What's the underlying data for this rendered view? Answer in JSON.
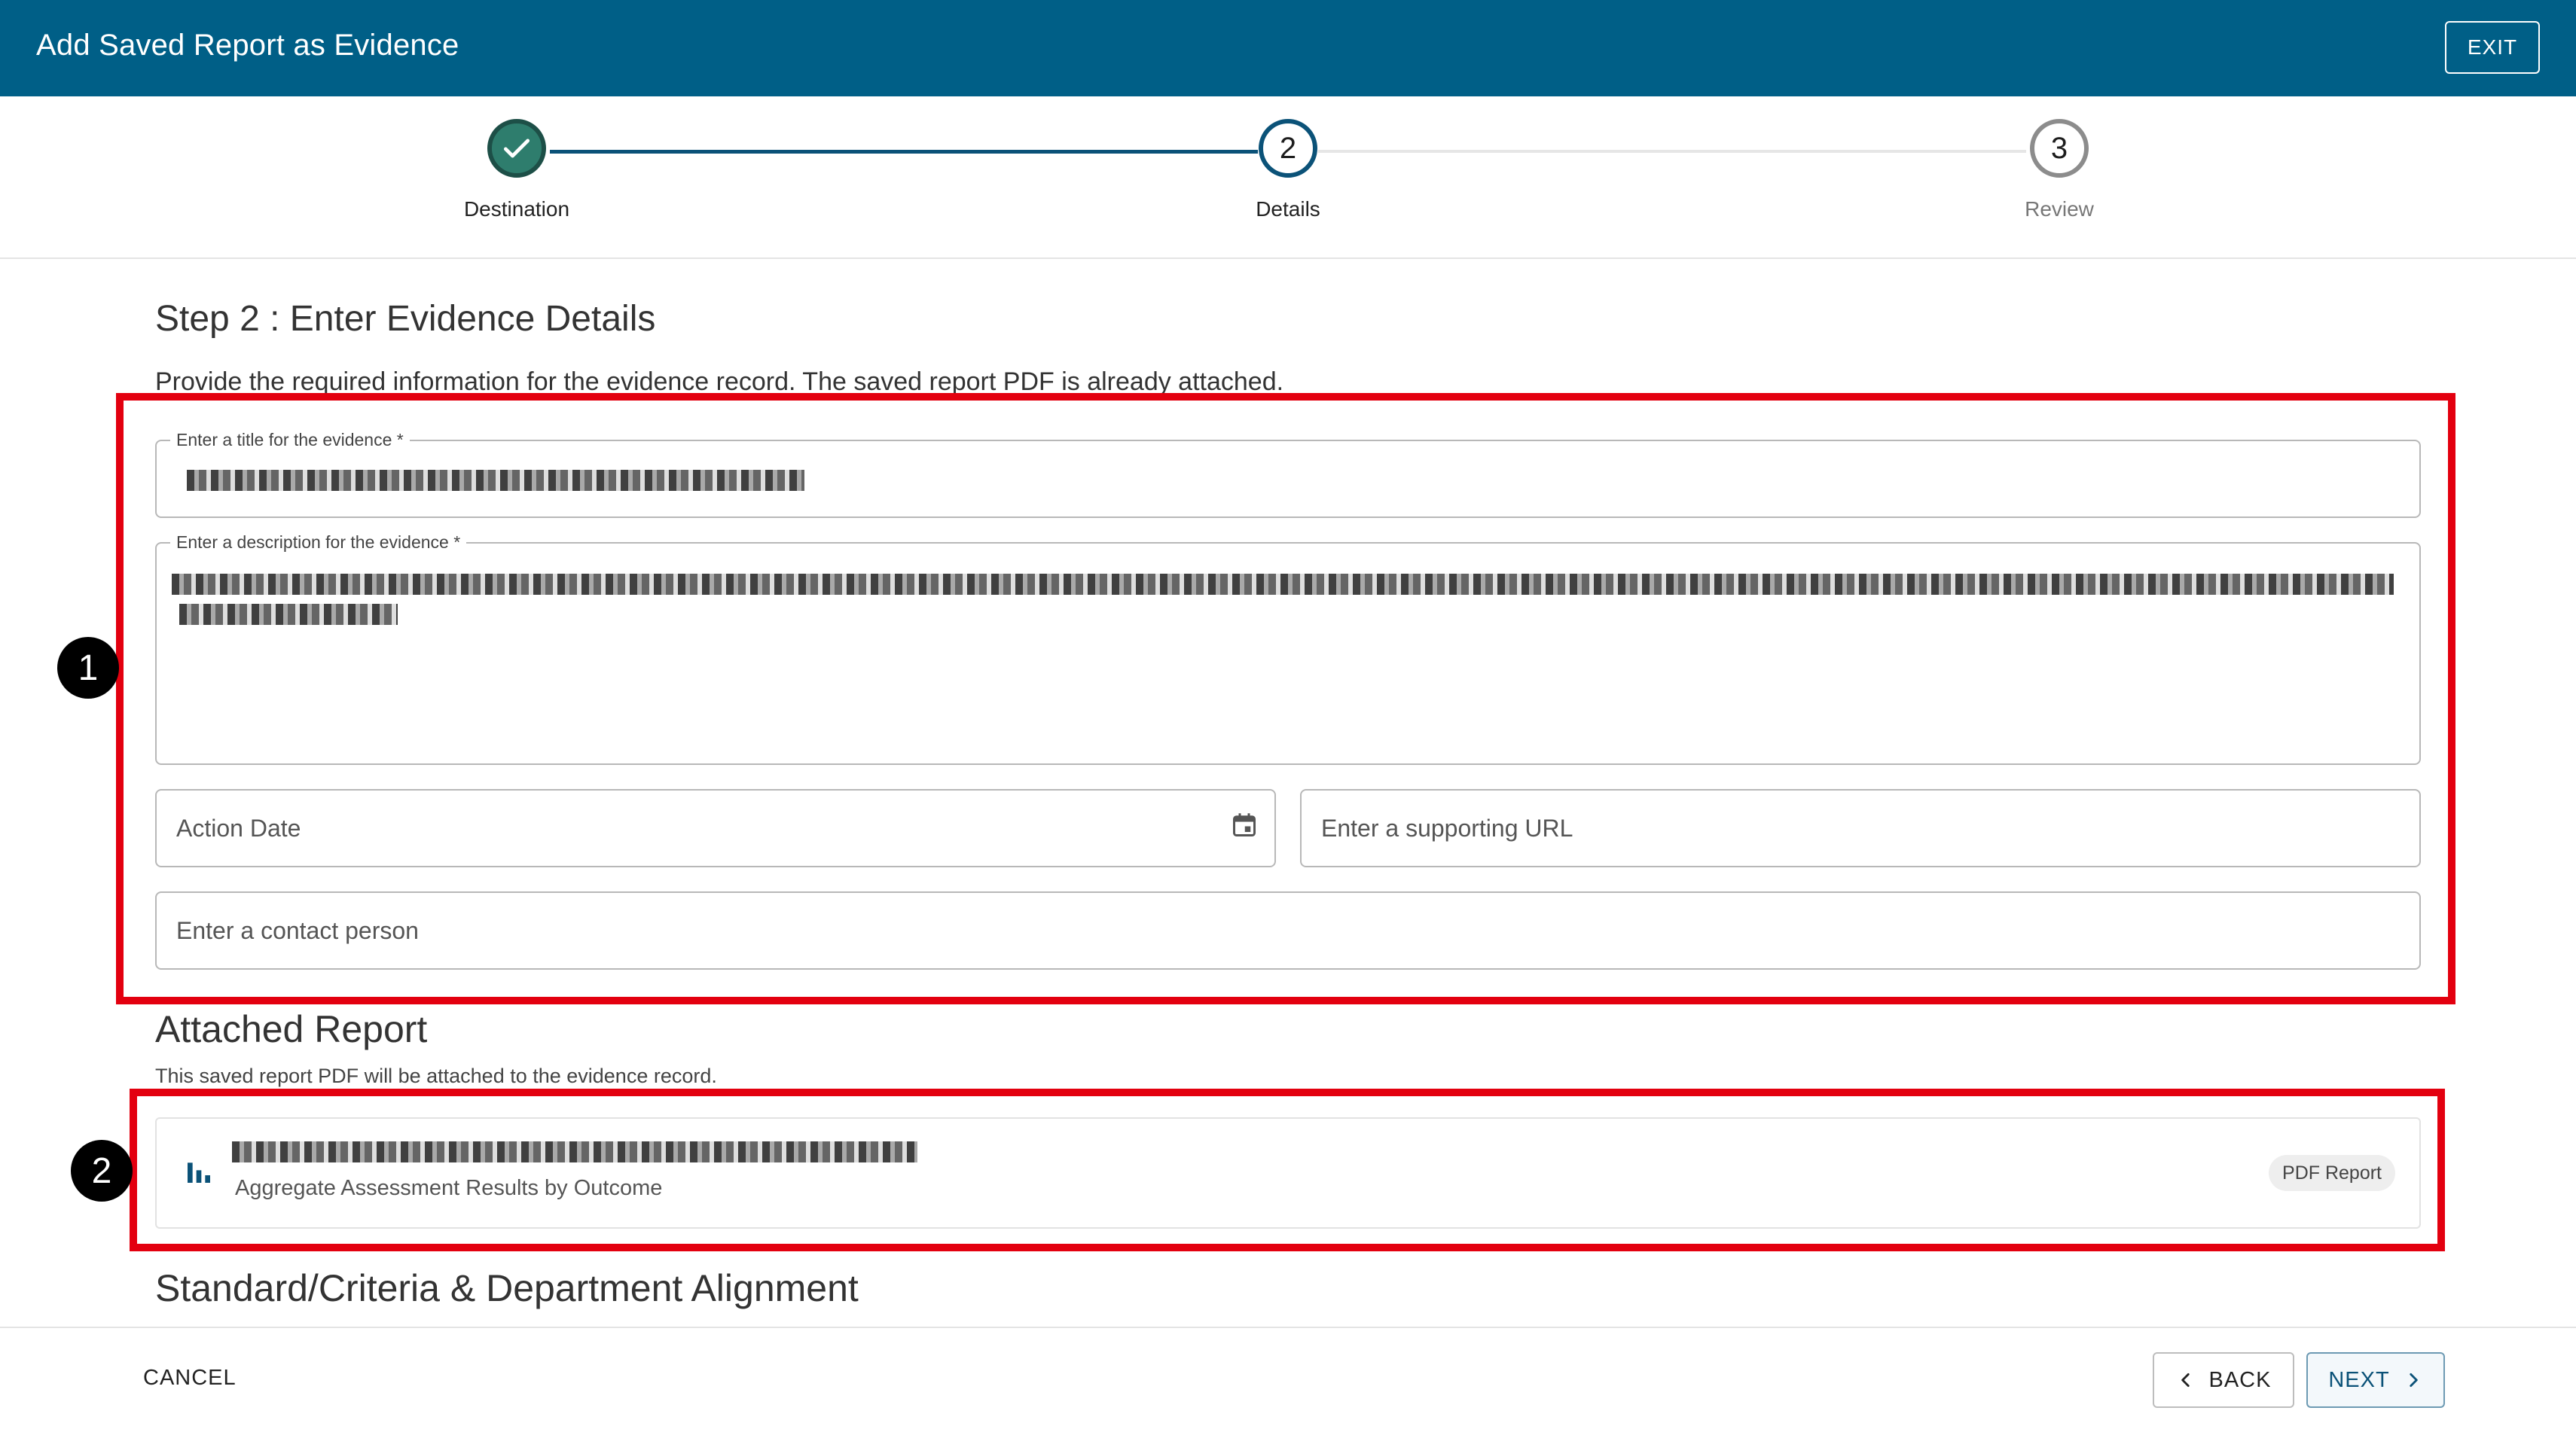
{
  "header": {
    "title": "Add Saved Report as Evidence",
    "exit_label": "EXIT"
  },
  "stepper": {
    "steps": [
      {
        "label": "Destination",
        "status": "complete",
        "number": "1"
      },
      {
        "label": "Details",
        "status": "active",
        "number": "2"
      },
      {
        "label": "Review",
        "status": "pending",
        "number": "3"
      }
    ]
  },
  "form": {
    "heading": "Step 2 : Enter Evidence Details",
    "description": "Provide the required information for the evidence record. The saved report PDF is already attached.",
    "title_field": {
      "label": "Enter a title for the evidence *",
      "value_redacted": true
    },
    "description_field": {
      "label": "Enter a description for the evidence *",
      "value_redacted": true
    },
    "action_date": {
      "placeholder": "Action Date",
      "icon": "calendar-icon"
    },
    "supporting_url": {
      "placeholder": "Enter a supporting URL"
    },
    "contact_person": {
      "placeholder": "Enter a contact person"
    }
  },
  "attached_report": {
    "heading": "Attached Report",
    "note": "This saved report PDF will be attached to the evidence record.",
    "icon": "bar-chart-icon",
    "subtitle": "Aggregate Assessment Results by Outcome",
    "badge": "PDF Report"
  },
  "alignment": {
    "heading": "Standard/Criteria & Department Alignment"
  },
  "annotations": [
    {
      "number": "1"
    },
    {
      "number": "2"
    }
  ],
  "footer": {
    "cancel_label": "CANCEL",
    "back_label": "BACK",
    "next_label": "NEXT"
  },
  "colors": {
    "header_bg": "#005f87",
    "accent": "#0b5278",
    "complete_step": "#2e7d6d",
    "annotation_red": "#e3000f"
  }
}
